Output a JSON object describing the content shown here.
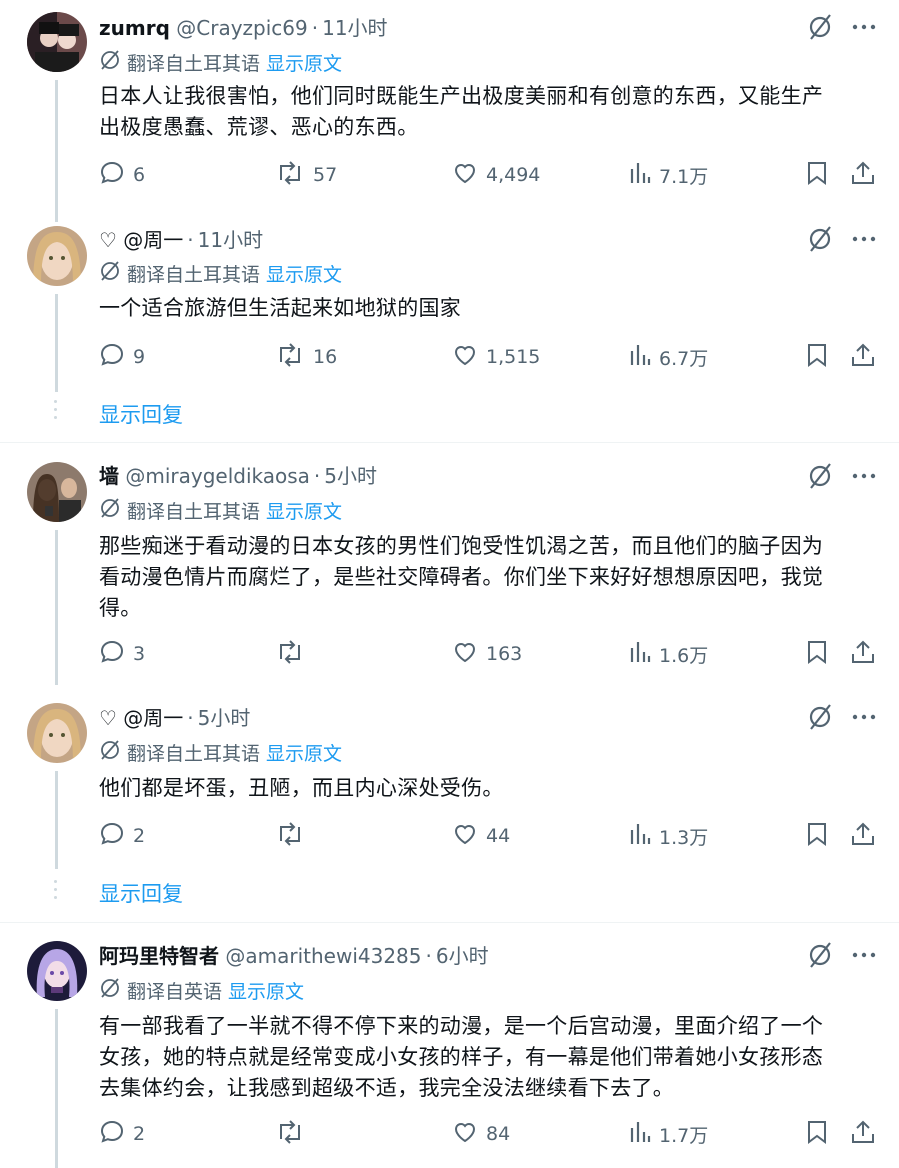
{
  "colors": {
    "accent": "#1d9bf0",
    "muted": "#536471",
    "text": "#0f1419",
    "line": "#cfd9de"
  },
  "tweets": [
    {
      "name": "zumrq",
      "handle": "@Crayzpic69",
      "sep": "·",
      "time": "11小时",
      "translate_note": "翻译自土耳其语",
      "show_original": "显示原文",
      "lines": [
        "日本人让我很害怕，他们同时既能生产出极度美丽和有创意的东西，又能生产",
        "出极度愚蠢、荒谬、恶心的东西。"
      ],
      "replies": "6",
      "retweets": "57",
      "likes": "4,494",
      "views": "7.1万"
    },
    {
      "name": "",
      "handle": "♡ @周一",
      "sep": "·",
      "time": "11小时",
      "translate_note": "翻译自土耳其语",
      "show_original": "显示原文",
      "lines": [
        "一个适合旅游但生活起来如地狱的国家"
      ],
      "replies": "9",
      "retweets": "16",
      "likes": "1,515",
      "views": "6.7万"
    },
    {
      "name": "墙",
      "handle": "@miraygeldikaosa",
      "sep": "·",
      "time": "5小时",
      "translate_note": "翻译自土耳其语",
      "show_original": "显示原文",
      "lines": [
        "那些痴迷于看动漫的日本女孩的男性们饱受性饥渴之苦，而且他们的脑子因为",
        "看动漫色情片而腐烂了，是些社交障碍者。你们坐下来好好想想原因吧，我觉",
        "得。"
      ],
      "replies": "3",
      "retweets": "",
      "likes": "163",
      "views": "1.6万"
    },
    {
      "name": "",
      "handle": "♡ @周一",
      "sep": "·",
      "time": "5小时",
      "translate_note": "翻译自土耳其语",
      "show_original": "显示原文",
      "lines": [
        "他们都是坏蛋，丑陋，而且内心深处受伤。"
      ],
      "replies": "2",
      "retweets": "",
      "likes": "44",
      "views": "1.3万"
    },
    {
      "name": "阿玛里特智者",
      "handle": "@amarithewi43285",
      "sep": "·",
      "time": "6小时",
      "translate_note": "翻译自英语",
      "show_original": "显示原文",
      "lines": [
        "有一部我看了一半就不得不停下来的动漫，是一个后宫动漫，里面介绍了一个",
        "女孩，她的特点就是经常变成小女孩的样子，有一幕是他们带着她小女孩形态",
        "去集体约会，让我感到超级不适，我完全没法继续看下去了。"
      ],
      "replies": "2",
      "retweets": "",
      "likes": "84",
      "views": "1.7万"
    }
  ],
  "show_replies": "显示回复",
  "icons": {
    "reply": "reply-icon",
    "retweet": "retweet-icon",
    "like": "heart-icon",
    "views": "views-icon",
    "bookmark": "bookmark-icon",
    "share": "share-icon",
    "grok": "grok-icon",
    "more": "more-icon",
    "translate": "translate-icon"
  }
}
